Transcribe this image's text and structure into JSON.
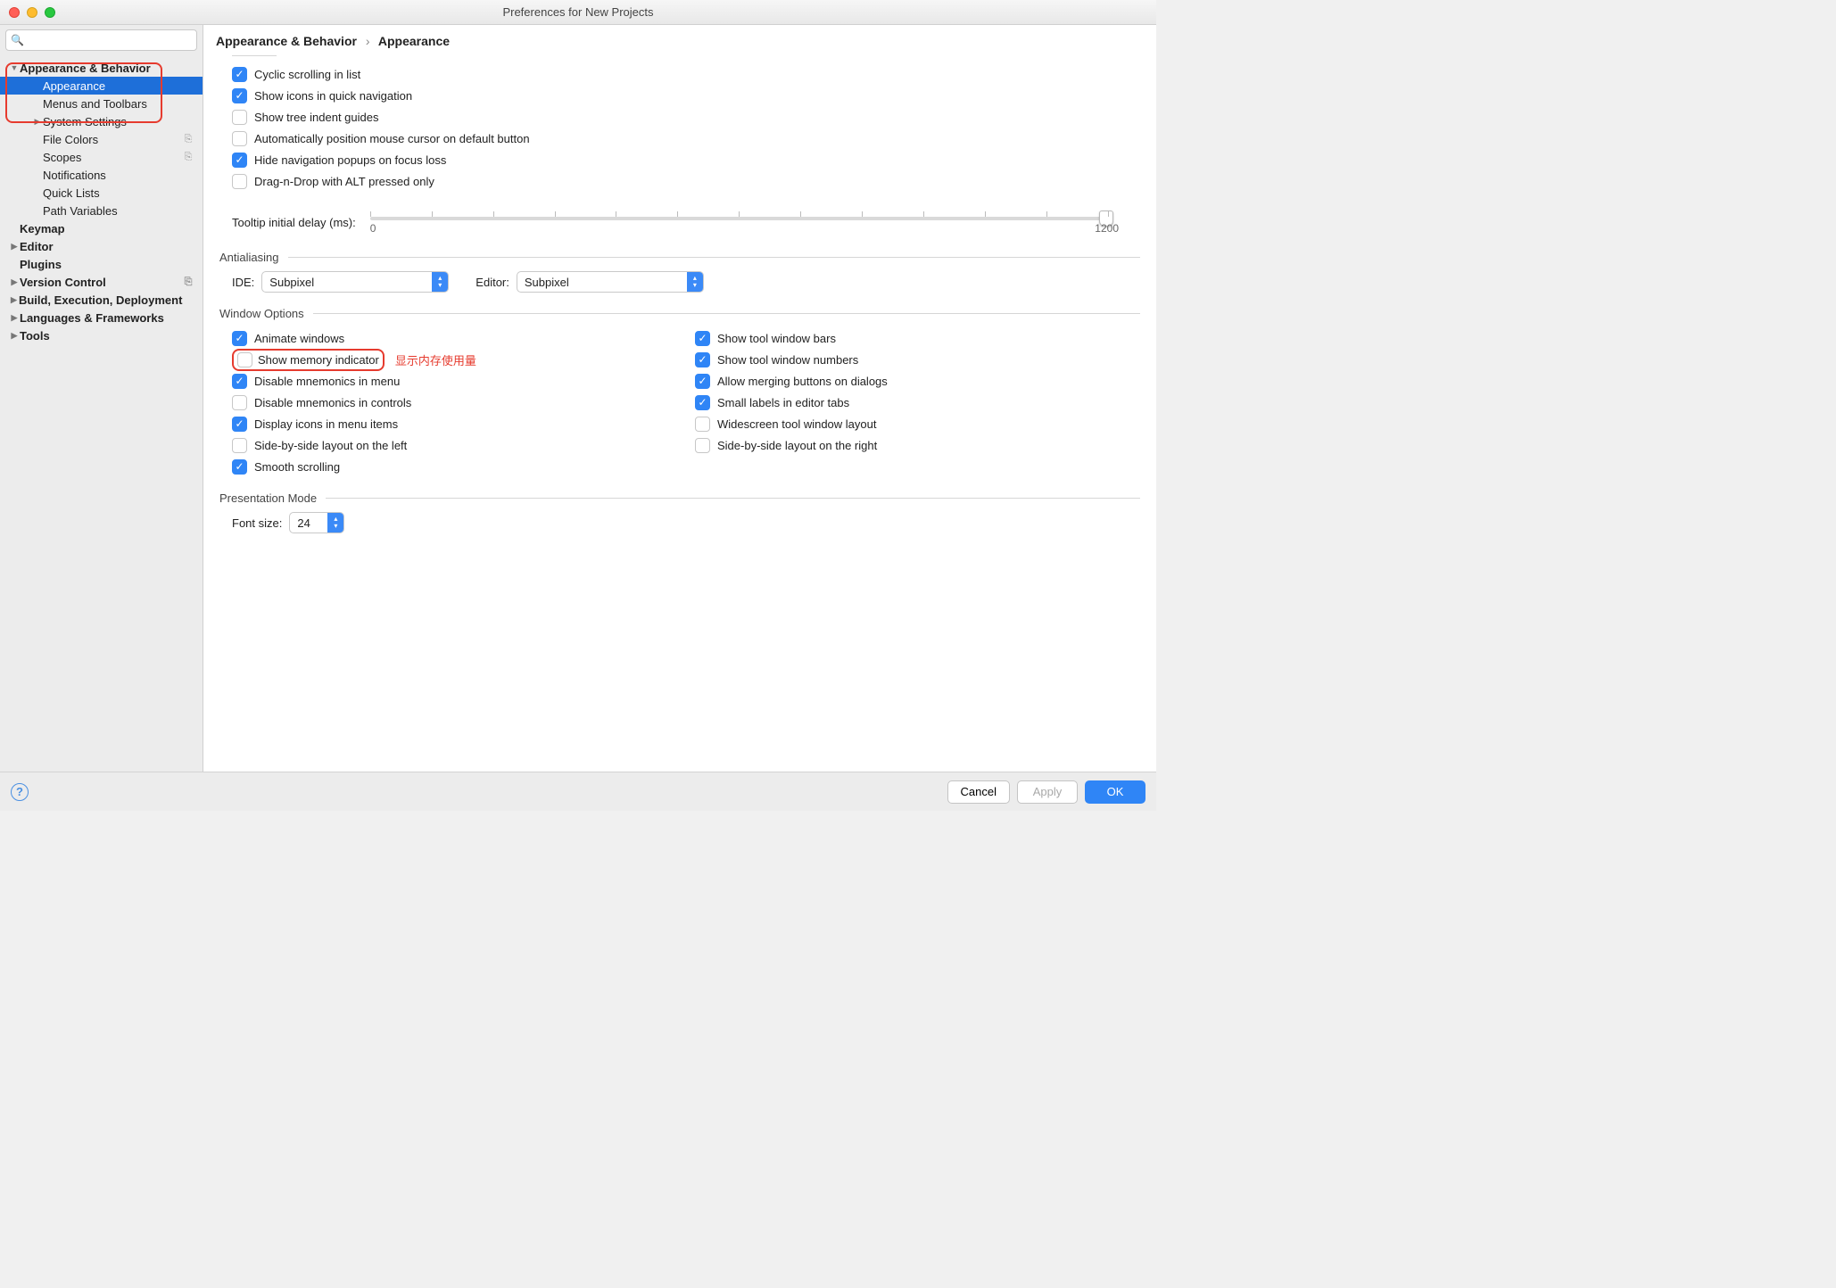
{
  "window": {
    "title": "Preferences for New Projects"
  },
  "search": {
    "placeholder": ""
  },
  "sidebar": {
    "items": [
      {
        "label": "Appearance & Behavior",
        "depth": 0,
        "bold": true,
        "disclosure": "▼",
        "extra": ""
      },
      {
        "label": "Appearance",
        "depth": 1,
        "bold": false,
        "disclosure": "",
        "extra": "",
        "selected": true
      },
      {
        "label": "Menus and Toolbars",
        "depth": 1,
        "bold": false,
        "disclosure": "",
        "extra": ""
      },
      {
        "label": "System Settings",
        "depth": 1,
        "bold": false,
        "disclosure": "▶",
        "extra": ""
      },
      {
        "label": "File Colors",
        "depth": 1,
        "bold": false,
        "disclosure": "",
        "extra": "⎘"
      },
      {
        "label": "Scopes",
        "depth": 1,
        "bold": false,
        "disclosure": "",
        "extra": "⎘"
      },
      {
        "label": "Notifications",
        "depth": 1,
        "bold": false,
        "disclosure": "",
        "extra": ""
      },
      {
        "label": "Quick Lists",
        "depth": 1,
        "bold": false,
        "disclosure": "",
        "extra": ""
      },
      {
        "label": "Path Variables",
        "depth": 1,
        "bold": false,
        "disclosure": "",
        "extra": ""
      },
      {
        "label": "Keymap",
        "depth": 0,
        "bold": true,
        "disclosure": "",
        "extra": ""
      },
      {
        "label": "Editor",
        "depth": 0,
        "bold": true,
        "disclosure": "▶",
        "extra": ""
      },
      {
        "label": "Plugins",
        "depth": 0,
        "bold": true,
        "disclosure": "",
        "extra": ""
      },
      {
        "label": "Version Control",
        "depth": 0,
        "bold": true,
        "disclosure": "▶",
        "extra": "⎘"
      },
      {
        "label": "Build, Execution, Deployment",
        "depth": 0,
        "bold": true,
        "disclosure": "▶",
        "extra": ""
      },
      {
        "label": "Languages & Frameworks",
        "depth": 0,
        "bold": true,
        "disclosure": "▶",
        "extra": ""
      },
      {
        "label": "Tools",
        "depth": 0,
        "bold": true,
        "disclosure": "▶",
        "extra": ""
      }
    ]
  },
  "breadcrumb": {
    "root": "Appearance & Behavior",
    "leaf": "Appearance",
    "sep": "›"
  },
  "options_top": [
    {
      "label": "Cyclic scrolling in list",
      "checked": true
    },
    {
      "label": "Show icons in quick navigation",
      "checked": true
    },
    {
      "label": "Show tree indent guides",
      "checked": false
    },
    {
      "label": "Automatically position mouse cursor on default button",
      "checked": false
    },
    {
      "label": "Hide navigation popups on focus loss",
      "checked": true
    },
    {
      "label": "Drag-n-Drop with ALT pressed only",
      "checked": false
    }
  ],
  "tooltip_slider": {
    "label": "Tooltip initial delay (ms):",
    "min": "0",
    "max": "1200",
    "value": 1200
  },
  "antialiasing": {
    "title": "Antialiasing",
    "ide_label": "IDE:",
    "ide_value": "Subpixel",
    "editor_label": "Editor:",
    "editor_value": "Subpixel"
  },
  "window_options": {
    "title": "Window Options",
    "left": [
      {
        "label": "Animate windows",
        "checked": true
      },
      {
        "label": "Show memory indicator",
        "checked": false,
        "annot": true
      },
      {
        "label": "Disable mnemonics in menu",
        "checked": true
      },
      {
        "label": "Disable mnemonics in controls",
        "checked": false
      },
      {
        "label": "Display icons in menu items",
        "checked": true
      },
      {
        "label": "Side-by-side layout on the left",
        "checked": false
      },
      {
        "label": "Smooth scrolling",
        "checked": true
      }
    ],
    "right": [
      {
        "label": "Show tool window bars",
        "checked": true
      },
      {
        "label": "Show tool window numbers",
        "checked": true
      },
      {
        "label": "Allow merging buttons on dialogs",
        "checked": true
      },
      {
        "label": "Small labels in editor tabs",
        "checked": true
      },
      {
        "label": "Widescreen tool window layout",
        "checked": false
      },
      {
        "label": "Side-by-side layout on the right",
        "checked": false
      }
    ],
    "annot_text": "显示内存使用量"
  },
  "presentation": {
    "title": "Presentation Mode",
    "font_label": "Font size:",
    "font_value": "24"
  },
  "footer": {
    "cancel": "Cancel",
    "apply": "Apply",
    "ok": "OK",
    "help": "?"
  }
}
